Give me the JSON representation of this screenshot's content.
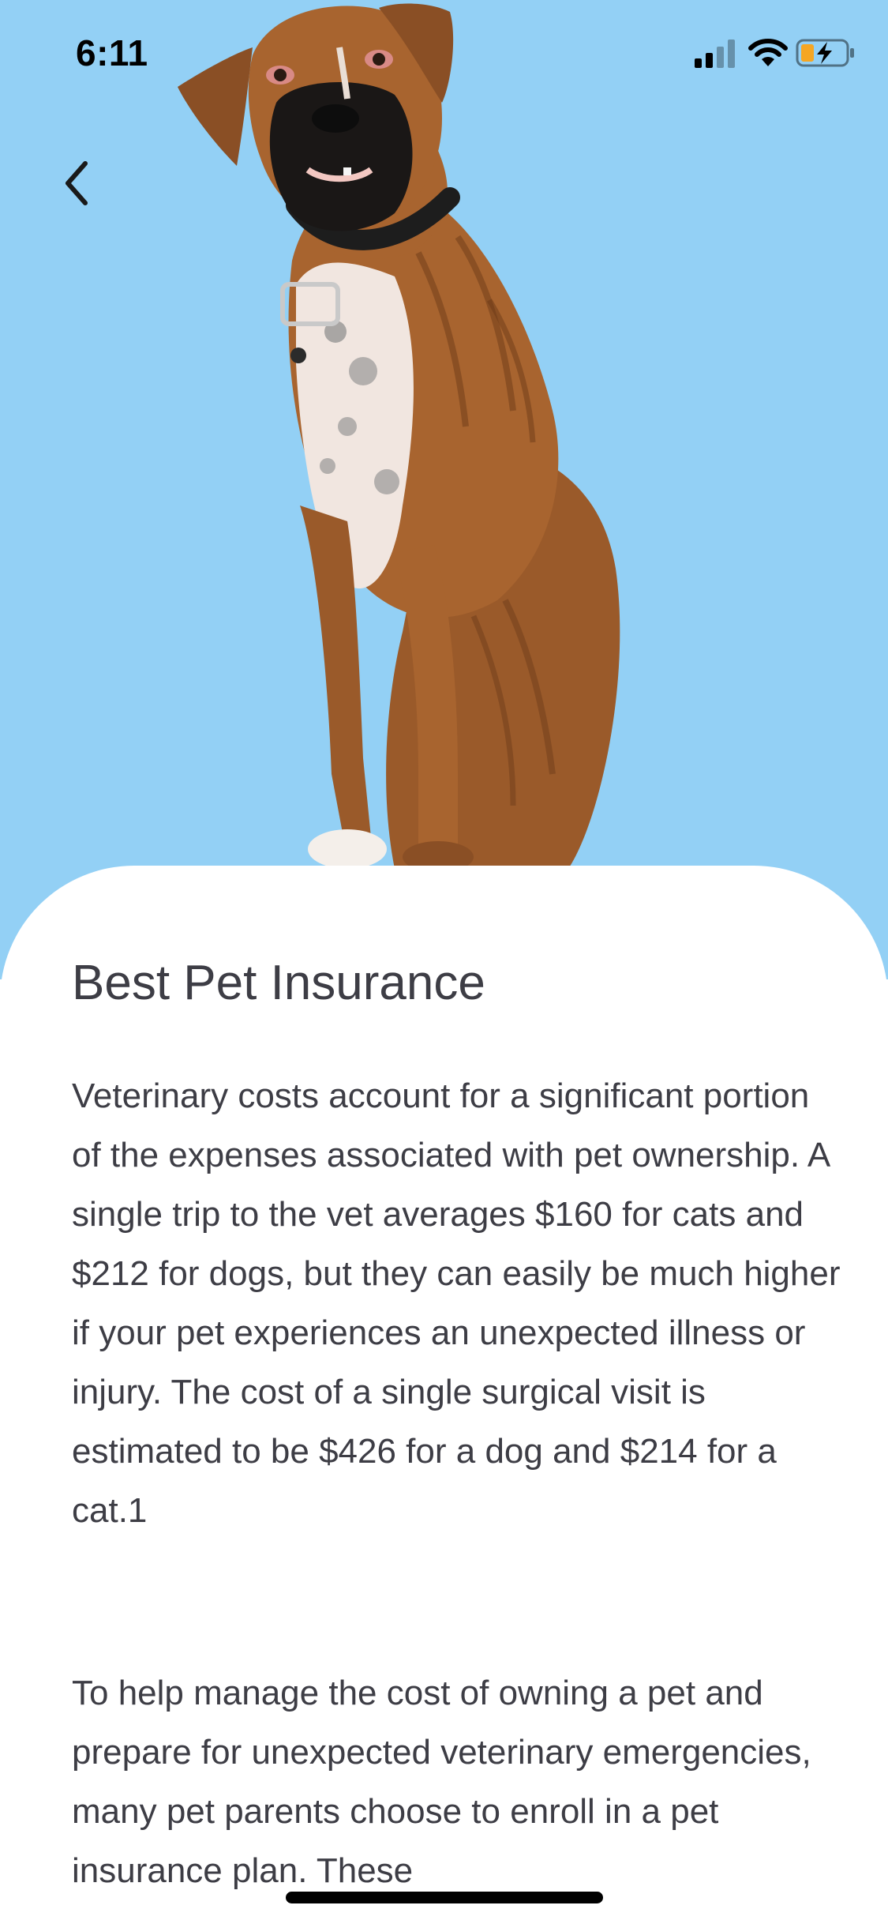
{
  "status_bar": {
    "time": "6:11",
    "signal_icon": "cellular-signal-icon",
    "wifi_icon": "wifi-icon",
    "battery_icon": "battery-charging-icon"
  },
  "header": {
    "back_icon": "chevron-left-icon"
  },
  "hero": {
    "image": "boxer-dog-photo",
    "background_color": "#93d0f5"
  },
  "article": {
    "title": "Best Pet Insurance",
    "paragraphs": [
      "Veterinary costs account for a significant portion of the expenses associated with pet ownership. A single trip to the vet averages $160 for cats and $212 for dogs, but they can easily be much higher if your pet experiences an unexpected illness or injury. The cost of a single surgical visit is estimated to be $426 for a dog and $214 for a cat.1",
      "To help manage the cost of owning a pet and prepare for unexpected veterinary emergencies, many pet parents choose to enroll in a pet insurance plan. These"
    ]
  },
  "colors": {
    "text": "#3d3d45",
    "sky": "#93d0f5",
    "battery_fill": "#f5a623"
  }
}
